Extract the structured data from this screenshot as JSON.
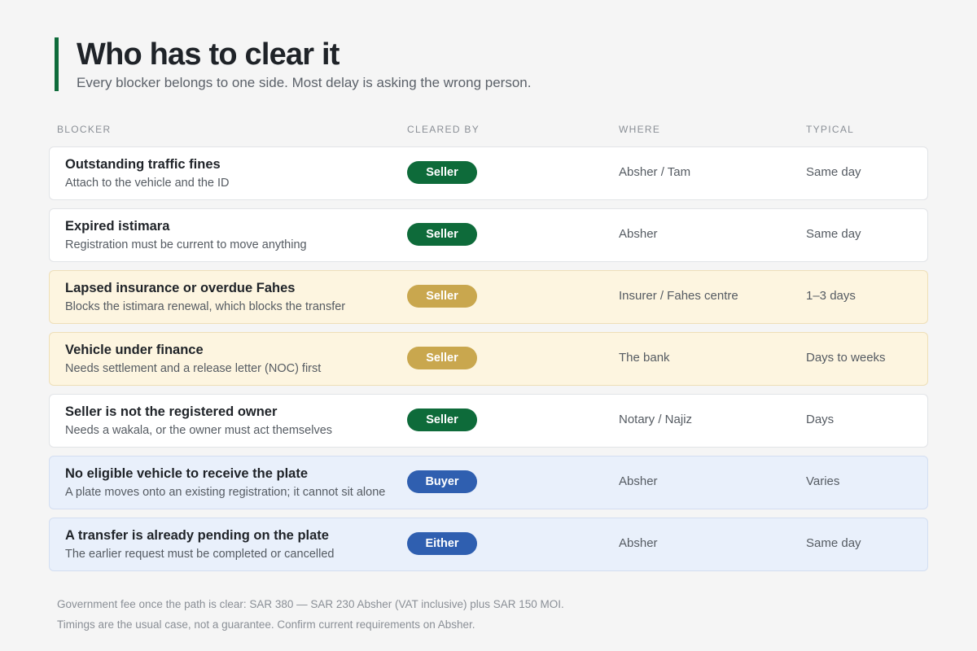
{
  "header": {
    "title": "Who has to clear it",
    "subtitle": "Every blocker belongs to one side. Most delay is asking the wrong person."
  },
  "columns": {
    "blocker": "BLOCKER",
    "cleared_by": "CLEARED BY",
    "where": "WHERE",
    "typical": "TYPICAL"
  },
  "colors": {
    "accent": "#0e6b3a",
    "seller": "#0e6b3a",
    "seller_muted": "#c9a74e",
    "buyer": "#2f5fb0",
    "yellow_tint": "#fdf5e0",
    "blue_tint": "#e9f0fb"
  },
  "rows": [
    {
      "title": "Outstanding traffic fines",
      "desc": "Attach to the vehicle and the ID",
      "cleared_by": "Seller",
      "where": "Absher / Tam",
      "typical": "Same day"
    },
    {
      "title": "Expired istimara",
      "desc": "Registration must be current to move anything",
      "cleared_by": "Seller",
      "where": "Absher",
      "typical": "Same day"
    },
    {
      "title": "Lapsed insurance or overdue Fahes",
      "desc": "Blocks the istimara renewal, which blocks the transfer",
      "cleared_by": "Seller",
      "where": "Insurer / Fahes centre",
      "typical": "1–3 days"
    },
    {
      "title": "Vehicle under finance",
      "desc": "Needs settlement and a release letter (NOC) first",
      "cleared_by": "Seller",
      "where": "The bank",
      "typical": "Days to weeks"
    },
    {
      "title": "Seller is not the registered owner",
      "desc": "Needs a wakala, or the owner must act themselves",
      "cleared_by": "Seller",
      "where": "Notary / Najiz",
      "typical": "Days"
    },
    {
      "title": "No eligible vehicle to receive the plate",
      "desc": "A plate moves onto an existing registration; it cannot sit alone",
      "cleared_by": "Buyer",
      "where": "Absher",
      "typical": "Varies"
    },
    {
      "title": "A transfer is already pending on the plate",
      "desc": "The earlier request must be completed or cancelled",
      "cleared_by": "Either",
      "where": "Absher",
      "typical": "Same day"
    }
  ],
  "footer": {
    "line1": "Government fee once the path is clear: SAR 380 — SAR 230 Absher (VAT inclusive) plus SAR 150 MOI.",
    "line2": "Timings are the usual case, not a guarantee. Confirm current requirements on Absher."
  }
}
